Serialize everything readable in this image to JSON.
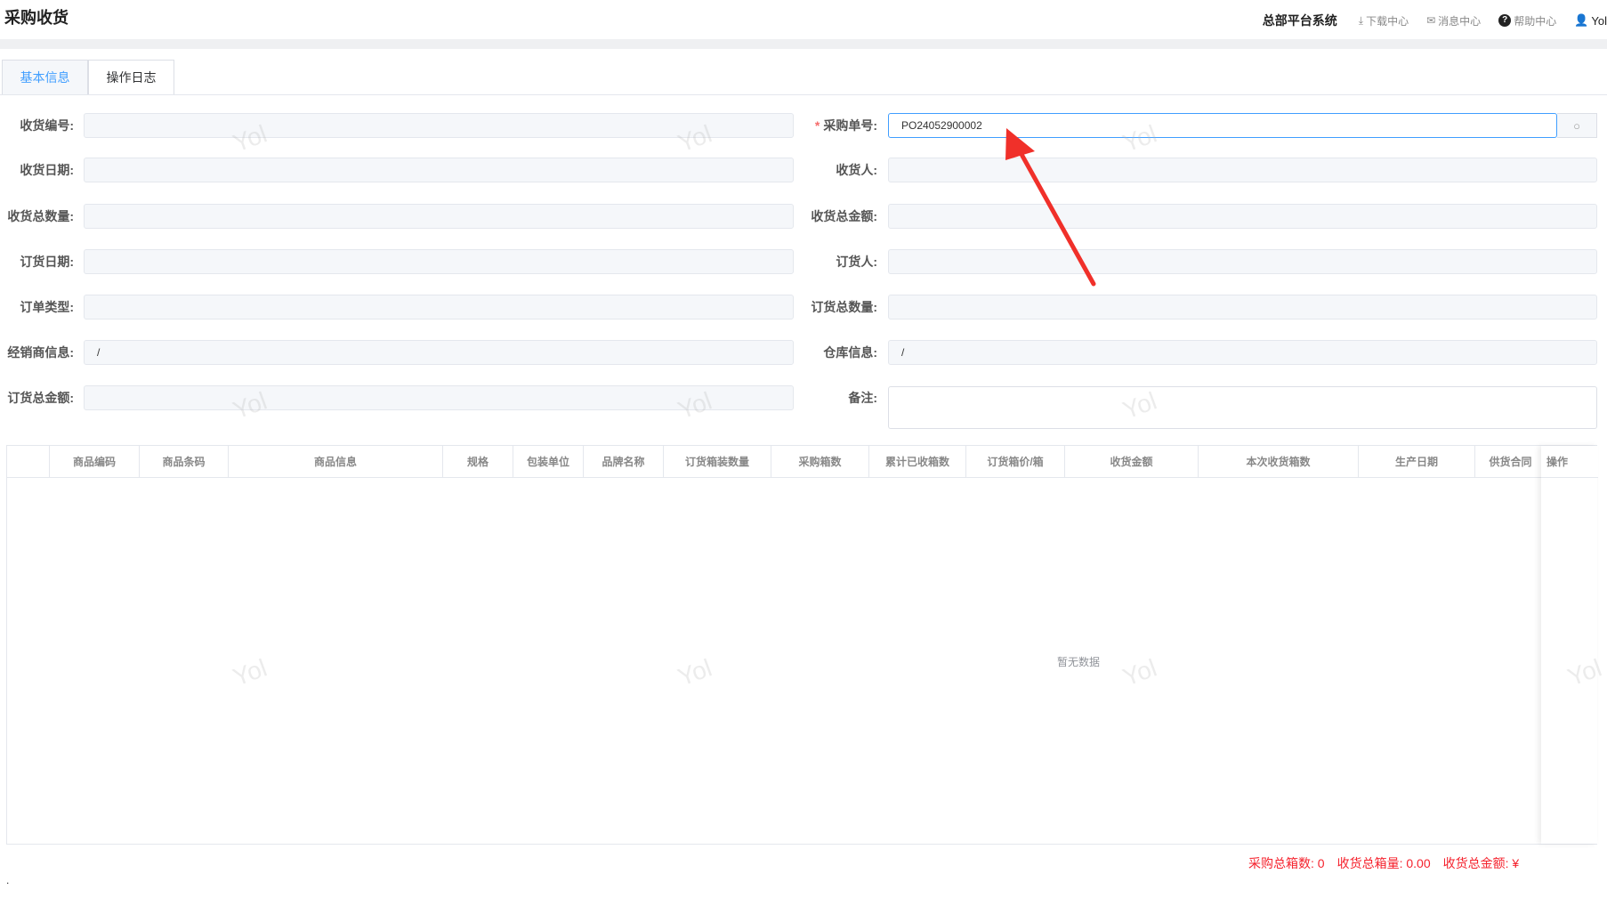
{
  "page_title": "采购收货",
  "topnav": {
    "system": "总部平台系统",
    "download": "下载中心",
    "messages": "消息中心",
    "help": "帮助中心",
    "user": "Yol"
  },
  "tabs": [
    "基本信息",
    "操作日志"
  ],
  "form": {
    "receipt_no": {
      "label": "收货编号:",
      "value": ""
    },
    "purchase_no": {
      "label": "采购单号:",
      "value": "PO24052900002"
    },
    "receipt_date": {
      "label": "收货日期:",
      "value": ""
    },
    "receiver": {
      "label": "收货人:",
      "value": ""
    },
    "receipt_total_qty": {
      "label": "收货总数量:",
      "value": ""
    },
    "receipt_total_amount": {
      "label": "收货总金额:",
      "value": ""
    },
    "order_date": {
      "label": "订货日期:",
      "value": ""
    },
    "orderer": {
      "label": "订货人:",
      "value": ""
    },
    "order_type": {
      "label": "订单类型:",
      "value": ""
    },
    "order_total_qty": {
      "label": "订货总数量:",
      "value": ""
    },
    "dealer_info": {
      "label": "经销商信息:",
      "value": "/"
    },
    "warehouse_info": {
      "label": "仓库信息:",
      "value": "/"
    },
    "order_total_amount": {
      "label": "订货总金额:",
      "value": ""
    },
    "remark": {
      "label": "备注:",
      "value": ""
    }
  },
  "table": {
    "columns": [
      "",
      "商品编码",
      "商品条码",
      "商品信息",
      "规格",
      "包装单位",
      "品牌名称",
      "订货箱装数量",
      "采购箱数",
      "累计已收箱数",
      "订货箱价/箱",
      "收货金额",
      "本次收货箱数",
      "生产日期",
      "供货合同",
      "操作"
    ],
    "empty_text": "暂无数据"
  },
  "summary": {
    "purchase_boxes": "采购总箱数: 0",
    "receipt_boxes": "收货总箱量: 0.00",
    "receipt_amount": "收货总金额: ¥"
  },
  "watermark": "Yol",
  "colors": {
    "accent": "#409eff",
    "summary": "#f5222d",
    "arrow": "#f0302a"
  }
}
